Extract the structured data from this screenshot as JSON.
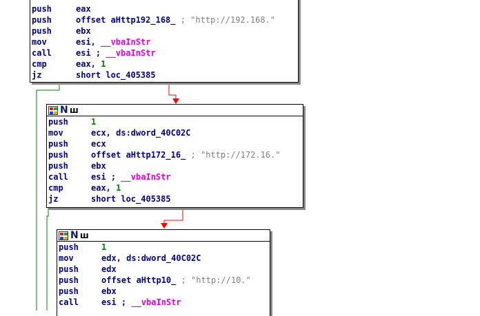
{
  "colors": {
    "edge_true": "#ff0000",
    "edge_false": "#008000",
    "mnemonic": "#000080",
    "number": "#008000",
    "import_fn": "#e000e0",
    "comment": "#808080"
  },
  "header_icons": [
    "graph-overview-icon",
    "n-rename-icon",
    "comment-icon"
  ],
  "header_labels": {
    "n": "N",
    "comment": "ш"
  },
  "blocks": [
    {
      "lines": [
        {
          "mn": "push",
          "parts": [
            {
              "t": "eax",
              "c": "sym"
            }
          ]
        },
        {
          "mn": "push",
          "parts": [
            {
              "t": "offset aHttp192_168_",
              "c": "sym"
            },
            {
              "t": " ; \"http://192.168.\"",
              "c": "cmt"
            }
          ]
        },
        {
          "mn": "push",
          "parts": [
            {
              "t": "ebx",
              "c": "sym"
            }
          ]
        },
        {
          "mn": "mov",
          "parts": [
            {
              "t": "esi, ",
              "c": "sym"
            },
            {
              "t": "__vbaInStr",
              "c": "fn"
            }
          ]
        },
        {
          "mn": "call",
          "parts": [
            {
              "t": "esi ; ",
              "c": "sym"
            },
            {
              "t": "__vbaInStr",
              "c": "fn"
            }
          ]
        },
        {
          "mn": "cmp",
          "parts": [
            {
              "t": "eax, ",
              "c": "sym"
            },
            {
              "t": "1",
              "c": "num"
            }
          ]
        },
        {
          "mn": "jz",
          "parts": [
            {
              "t": "short loc_405385",
              "c": "sym"
            }
          ]
        }
      ]
    },
    {
      "lines": [
        {
          "mn": "push",
          "parts": [
            {
              "t": "1",
              "c": "num"
            }
          ]
        },
        {
          "mn": "mov",
          "parts": [
            {
              "t": "ecx, ds:dword_40C02C",
              "c": "sym"
            }
          ]
        },
        {
          "mn": "push",
          "parts": [
            {
              "t": "ecx",
              "c": "sym"
            }
          ]
        },
        {
          "mn": "push",
          "parts": [
            {
              "t": "offset aHttp172_16_",
              "c": "sym"
            },
            {
              "t": " ; \"http://172.16.\"",
              "c": "cmt"
            }
          ]
        },
        {
          "mn": "push",
          "parts": [
            {
              "t": "ebx",
              "c": "sym"
            }
          ]
        },
        {
          "mn": "call",
          "parts": [
            {
              "t": "esi ; ",
              "c": "sym"
            },
            {
              "t": "__vbaInStr",
              "c": "fn"
            }
          ]
        },
        {
          "mn": "cmp",
          "parts": [
            {
              "t": "eax, ",
              "c": "sym"
            },
            {
              "t": "1",
              "c": "num"
            }
          ]
        },
        {
          "mn": "jz",
          "parts": [
            {
              "t": "short loc_405385",
              "c": "sym"
            }
          ]
        }
      ]
    },
    {
      "lines": [
        {
          "mn": "push",
          "parts": [
            {
              "t": "1",
              "c": "num"
            }
          ]
        },
        {
          "mn": "mov",
          "parts": [
            {
              "t": "edx, ds:dword_40C02C",
              "c": "sym"
            }
          ]
        },
        {
          "mn": "push",
          "parts": [
            {
              "t": "edx",
              "c": "sym"
            }
          ]
        },
        {
          "mn": "push",
          "parts": [
            {
              "t": "offset aHttp10_",
              "c": "sym"
            },
            {
              "t": " ; \"http://10.\"",
              "c": "cmt"
            }
          ]
        },
        {
          "mn": "push",
          "parts": [
            {
              "t": "ebx",
              "c": "sym"
            }
          ]
        },
        {
          "mn": "call",
          "parts": [
            {
              "t": "esi ; ",
              "c": "sym"
            },
            {
              "t": "__vbaInStr",
              "c": "fn"
            }
          ]
        }
      ]
    }
  ]
}
